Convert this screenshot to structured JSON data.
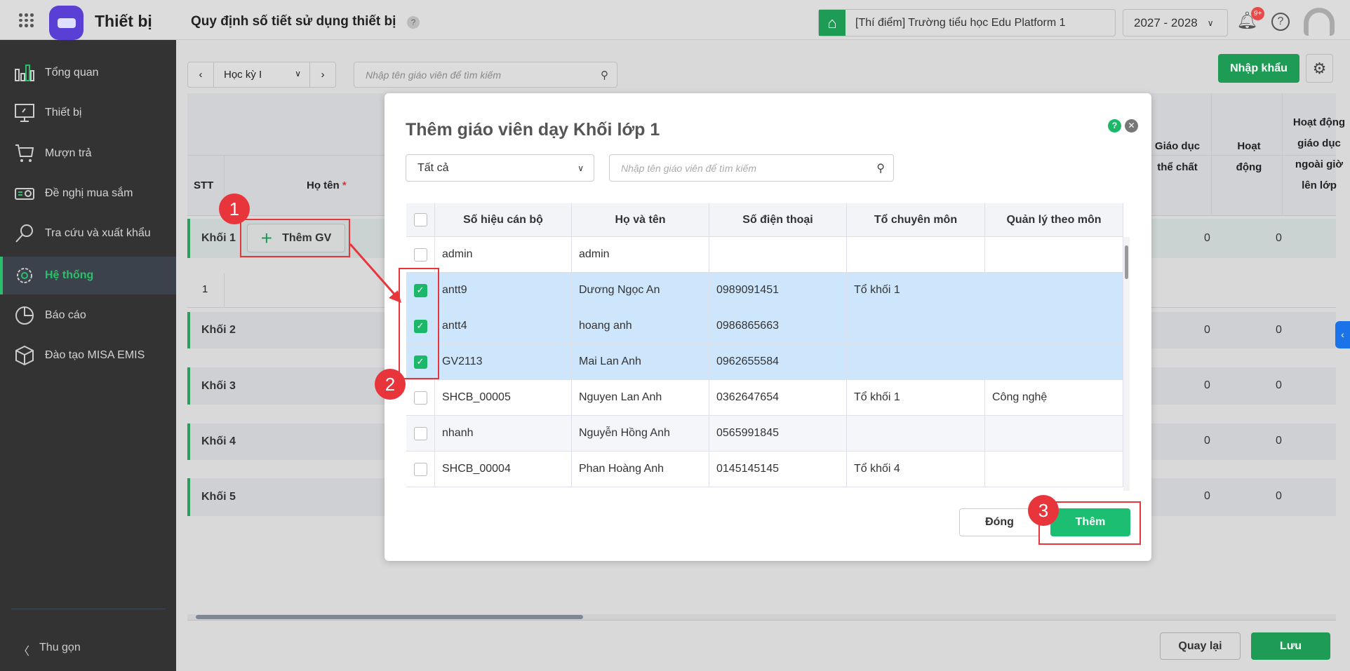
{
  "header": {
    "app_name": "Thiết bị",
    "page_title": "Quy định số tiết sử dụng thiết bị",
    "help": "?",
    "school": "[Thí điểm] Trường tiểu học Edu Platform 1",
    "year": "2027 - 2028",
    "notifications": "9+"
  },
  "sidebar": {
    "items": [
      {
        "label": "Tổng quan"
      },
      {
        "label": "Thiết bị"
      },
      {
        "label": "Mượn trả"
      },
      {
        "label": "Đề nghị mua sắm"
      },
      {
        "label": "Tra cứu và xuất khẩu"
      },
      {
        "label": "Hệ thống"
      },
      {
        "label": "Báo cáo"
      },
      {
        "label": "Đào tạo MISA EMIS"
      }
    ],
    "collapse": "Thu gọn"
  },
  "toolbar": {
    "semester": "Học kỳ I",
    "search_placeholder": "Nhập tên giáo viên để tìm kiếm",
    "import": "Nhập khẩu"
  },
  "table": {
    "headers": {
      "stt": "STT",
      "name": "Họ tên",
      "required": "*",
      "pe": "Giáo dục thể chất",
      "activity": "Hoạt động",
      "extra": "Hoạt động giáo dục ngoài giờ lên lớp"
    },
    "groups": [
      {
        "label": "Khối 1",
        "v1": "0",
        "v2": "0"
      },
      {
        "label": "Khối 2",
        "v1": "0",
        "v2": "0"
      },
      {
        "label": "Khối 3",
        "v1": "0",
        "v2": "0"
      },
      {
        "label": "Khối 4",
        "v1": "0",
        "v2": "0"
      },
      {
        "label": "Khối 5",
        "v1": "0",
        "v2": "0"
      }
    ],
    "row1_stt": "1",
    "add_teacher": "Thêm GV"
  },
  "footer": {
    "back": "Quay lại",
    "save": "Lưu"
  },
  "modal": {
    "title": "Thêm giáo viên dạy Khối lớp 1",
    "filter": "Tất cả",
    "search_placeholder": "Nhập tên giáo viên để tìm kiếm",
    "columns": [
      "Số hiệu cán bộ",
      "Họ và tên",
      "Số điện thoại",
      "Tổ chuyên môn",
      "Quản lý theo môn"
    ],
    "rows": [
      {
        "id": "admin",
        "name": "admin",
        "phone": "",
        "dept": "",
        "subject": "",
        "checked": false
      },
      {
        "id": "antt9",
        "name": "Dương Ngọc An",
        "phone": "0989091451",
        "dept": "Tổ khối 1",
        "subject": "",
        "checked": true
      },
      {
        "id": "antt4",
        "name": "hoang anh",
        "phone": "0986865663",
        "dept": "",
        "subject": "",
        "checked": true
      },
      {
        "id": "GV2113",
        "name": "Mai Lan Anh",
        "phone": "0962655584",
        "dept": "",
        "subject": "",
        "checked": true
      },
      {
        "id": "SHCB_00005",
        "name": "Nguyen Lan Anh",
        "phone": "0362647654",
        "dept": "Tổ khối 1",
        "subject": "Công nghệ",
        "checked": false
      },
      {
        "id": "nhanh",
        "name": "Nguyễn Hồng Anh",
        "phone": "0565991845",
        "dept": "",
        "subject": "",
        "checked": false
      },
      {
        "id": "SHCB_00004",
        "name": "Phan Hoàng Anh",
        "phone": "0145145145",
        "dept": "Tổ khối 4",
        "subject": "",
        "checked": false
      }
    ],
    "close": "Đóng",
    "add": "Thêm"
  },
  "annotations": [
    "1",
    "2",
    "3"
  ],
  "colors": {
    "green": "#1cb86a",
    "selected_row": "#cde6fb",
    "annotation": "#e8353b"
  }
}
